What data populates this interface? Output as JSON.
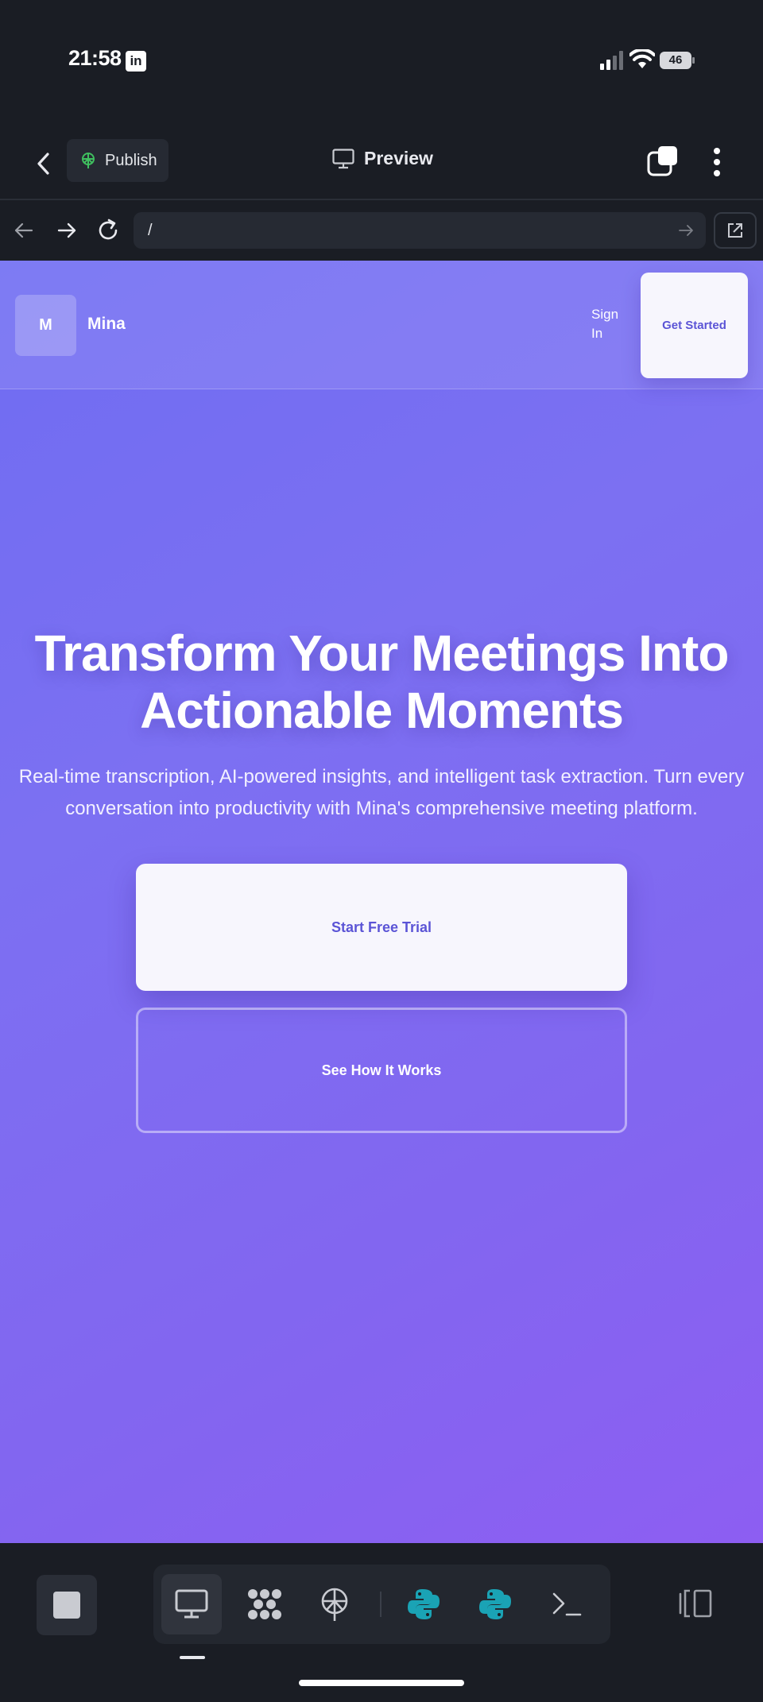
{
  "status_bar": {
    "time": "21:58",
    "notification_icon": "linkedin-icon",
    "battery_level": "46"
  },
  "app_header": {
    "publish_label": "Publish",
    "preview_label": "Preview"
  },
  "url_bar": {
    "url": "/"
  },
  "site": {
    "logo_letter": "M",
    "brand_name": "Mina",
    "signin_line1": "Sign",
    "signin_line2": "In",
    "get_started_label": "Get Started",
    "hero_title_line1": "Transform Your Meetings Into",
    "hero_title_line2": "Actionable Moments",
    "hero_subtitle": "Real-time transcription, AI-powered insights, and intelligent task extraction. Turn every conversation into productivity with Mina's comprehensive meeting platform.",
    "primary_cta": "Start Free Trial",
    "secondary_cta": "See How It Works"
  },
  "toolbar": {
    "items": [
      "stop-icon",
      "monitor-icon",
      "ai-agent-icon",
      "publish-icon",
      "python-icon",
      "python-icon",
      "terminal-icon",
      "panel-toggle-icon"
    ]
  },
  "colors": {
    "app_background": "#1a1d24",
    "hero_gradient_start": "#6f6cf2",
    "hero_gradient_end": "#8d5ef2",
    "button_text": "#5b54d6",
    "python_teal": "#1aa3b5"
  }
}
